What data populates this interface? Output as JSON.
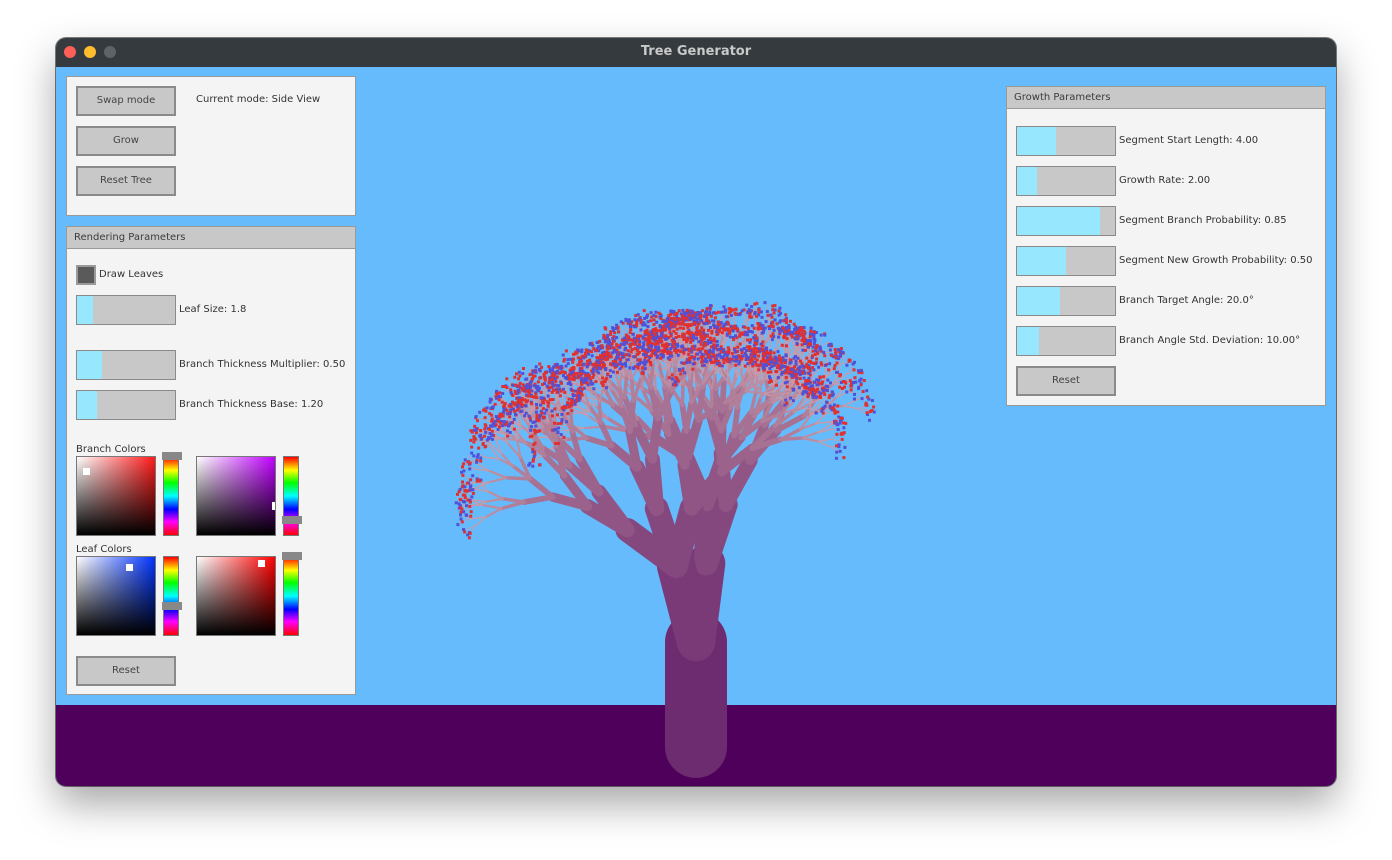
{
  "window": {
    "title": "Tree Generator"
  },
  "colors": {
    "sky": "#66bbfc",
    "ground": "#4e005a",
    "trunk": "#6e2c70",
    "branch_tip": "#c89aa8",
    "leaf_a": "#e03030",
    "leaf_b": "#5050d8",
    "slider_fill": "#97e8ff"
  },
  "controls": {
    "swap_mode_label": "Swap mode",
    "current_mode": "Current mode: Side View",
    "grow_label": "Grow",
    "reset_tree_label": "Reset Tree"
  },
  "rendering": {
    "title": "Rendering Parameters",
    "draw_leaves_label": "Draw Leaves",
    "draw_leaves_checked": true,
    "leaf_size": {
      "label": "Leaf Size: 1.8",
      "fraction": 0.16
    },
    "branch_thickness_multiplier": {
      "label": "Branch Thickness Multiplier: 0.50",
      "fraction": 0.25
    },
    "branch_thickness_base": {
      "label": "Branch Thickness Base: 1.20",
      "fraction": 0.2
    },
    "branch_colors_label": "Branch Colors",
    "leaf_colors_label": "Leaf Colors",
    "branch_color_start_hue": "#ff1a1a",
    "branch_color_end_hue": "#c000ff",
    "leaf_color_start_hue": "#0033ff",
    "leaf_color_end_hue": "#ff0000",
    "reset_label": "Reset"
  },
  "growth": {
    "title": "Growth Parameters",
    "segment_start_length": {
      "label": "Segment Start Length: 4.00",
      "fraction": 0.4
    },
    "growth_rate": {
      "label": "Growth Rate: 2.00",
      "fraction": 0.2
    },
    "segment_branch_probability": {
      "label": "Segment Branch Probability: 0.85",
      "fraction": 0.85
    },
    "segment_new_growth_probability": {
      "label": "Segment New Growth Probability: 0.50",
      "fraction": 0.5
    },
    "branch_target_angle": {
      "label": "Branch Target Angle: 20.0°",
      "fraction": 0.44
    },
    "branch_angle_std_deviation": {
      "label": "Branch Angle Std. Deviation: 10.00°",
      "fraction": 0.22
    },
    "reset_label": "Reset"
  }
}
